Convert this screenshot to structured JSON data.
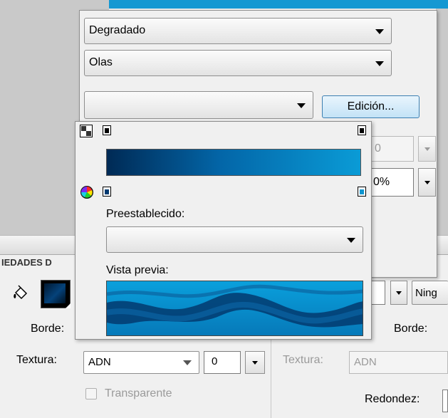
{
  "panel": {
    "strip_title": "IEDADES D",
    "border_left_label": "Borde:",
    "border_right_label": "Borde:",
    "texture_label_left": "Textura:",
    "texture_value_left": "ADN",
    "texture_number_left": "0",
    "texture_label_right": "Textura:",
    "texture_value_right": "ADN",
    "transparent_label": "Transparente",
    "roundness_label": "Redondez:",
    "none_select_value": "Ning"
  },
  "fill_popup": {
    "fill_type": "Degradado",
    "gradient_style": "Olas",
    "third_dropdown": "",
    "edit_button": "Edición...",
    "disabled_value": "0",
    "percent_value": "0%"
  },
  "gradient_editor": {
    "preset_label": "Preestablecido:",
    "preset_value": "",
    "preview_label": "Vista previa:",
    "colors": {
      "start": "#002a55",
      "mid": "#0366a8",
      "end": "#0a9bd6"
    }
  },
  "icons": [
    "checker-icon",
    "color-wheel-icon",
    "paint-bucket-icon",
    "stop-marker-icon"
  ]
}
